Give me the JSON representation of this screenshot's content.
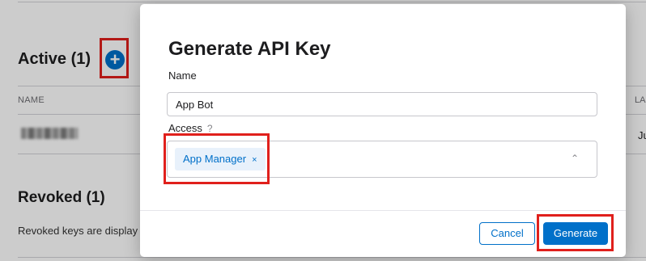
{
  "page": {
    "active_title": "Active (1)",
    "add_icon": "+",
    "column_name": "NAME",
    "column_right_partial": "LA",
    "row_right_partial": "Ju",
    "revoked_title": "Revoked (1)",
    "revoked_description": "Revoked keys are display"
  },
  "modal": {
    "title": "Generate API Key",
    "name_label": "Name",
    "name_value": "App Bot",
    "access_label": "Access",
    "access_help": "?",
    "access_chip": "App Manager",
    "chip_remove": "×",
    "caret": "⌃",
    "cancel_label": "Cancel",
    "generate_label": "Generate"
  },
  "colors": {
    "accent": "#0070c9",
    "annotation": "#e0201c"
  }
}
